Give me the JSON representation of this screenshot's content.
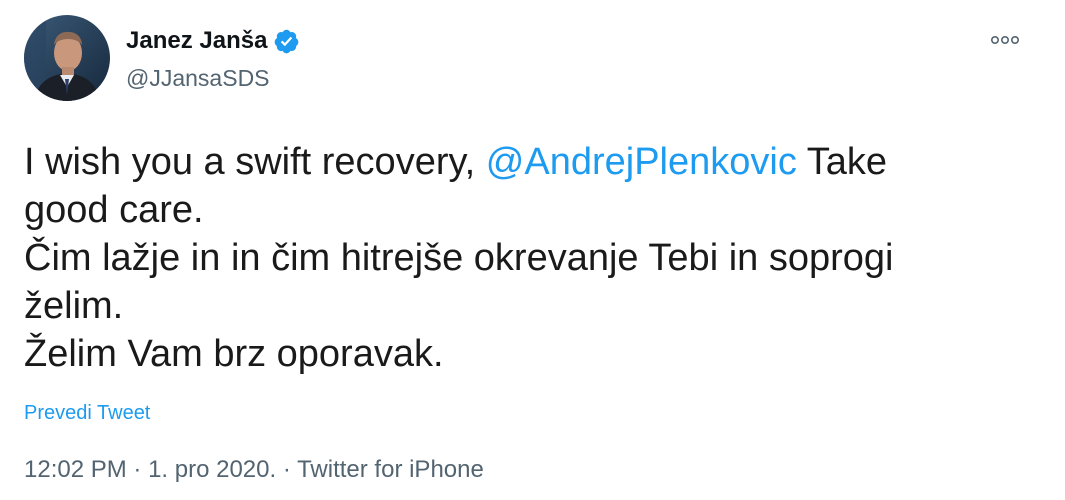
{
  "author": {
    "display_name": "Janez Janša",
    "handle": "@JJansaSDS",
    "verified_icon": "verified-badge-icon",
    "badge_color": "#1d9bf0"
  },
  "menu": {
    "icon": "more-options-icon"
  },
  "tweet": {
    "line1_before": "I wish you a swift recovery, ",
    "line1_mention": "@AndrejPlenkovic",
    "line1_after": " Take",
    "line2": "good care.",
    "line3": "Čim lažje in in čim hitrejše okrevanje Tebi in soprogi",
    "line4": "želim.",
    "line5": "Želim Vam brz oporavak."
  },
  "translate_label": "Prevedi Tweet",
  "meta": {
    "time": "12:02 PM",
    "separator": " · ",
    "date": "1. pro 2020.",
    "source": "Twitter for iPhone"
  },
  "colors": {
    "link": "#1d9bf0",
    "secondary_text": "#536471",
    "primary_text": "#0f1419"
  }
}
